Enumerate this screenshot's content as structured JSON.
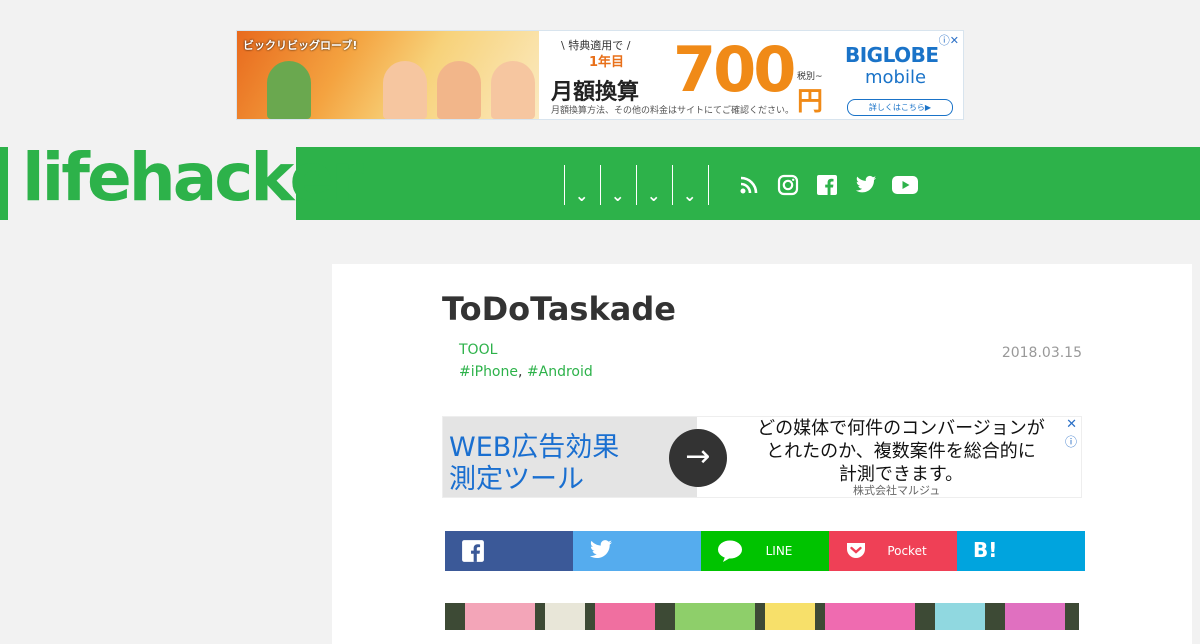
{
  "top_ad": {
    "photo_tag": "ビックリビッグローブ!",
    "line1": "\\ 特典適用で /",
    "line2": "1年目",
    "line3": "月額換算",
    "price": "700",
    "tax": "税別~",
    "yen": "円",
    "note": "月額換算方法、その他の料金はサイトにてご確認ください。",
    "brand1": "BIGLOBE",
    "brand2": "mobile",
    "more": "詳しくはこちら▶",
    "adchoice": "ⓘ✕"
  },
  "header": {
    "logo": "lifehacker",
    "menu_arrows": [
      "⌄",
      "⌄",
      "⌄",
      "⌄"
    ],
    "social_icons": [
      "rss-icon",
      "instagram-icon",
      "facebook-icon",
      "twitter-icon",
      "youtube-icon"
    ],
    "accent": "#2db24a"
  },
  "article": {
    "title": "ToDoTaskade",
    "category": "TOOL",
    "tags": [
      "#iPhone",
      "#Android"
    ],
    "tag_sep": ",",
    "date": "2018.03.15"
  },
  "mid_ad": {
    "title1": "WEB広告効果",
    "title2": "測定ツール",
    "arrow": "→",
    "copy": [
      "どの媒体で何件のコンバージョンが",
      "とれたのか、複数案件を総合的に",
      "計測できます。"
    ],
    "company": "株式会社マルジュ",
    "close": "✕",
    "info": "ⓘ"
  },
  "share": {
    "line_label": "LINE",
    "pocket_label": "Pocket",
    "hatena_label": "B!",
    "colors": {
      "facebook": "#3b5998",
      "twitter": "#55acee",
      "line": "#00c300",
      "pocket": "#ef4056",
      "hatena": "#00a4de"
    }
  }
}
